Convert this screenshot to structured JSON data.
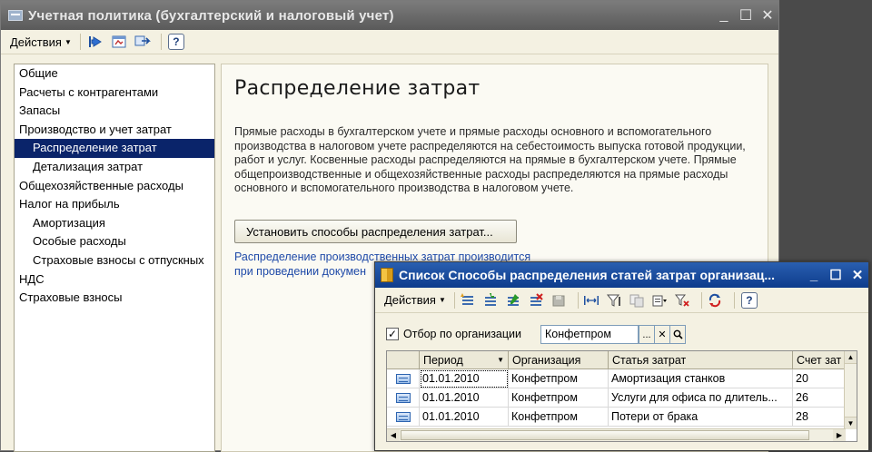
{
  "main_window": {
    "title": "Учетная политика (бухгалтерский и налоговый учет)",
    "controls": {
      "minimize": "_",
      "maximize": "☐",
      "close": "✕"
    },
    "toolbar": {
      "actions_label": "Действия",
      "help": "?"
    }
  },
  "nav": {
    "items": [
      {
        "label": "Общие",
        "sub": false
      },
      {
        "label": "Расчеты с контрагентами",
        "sub": false
      },
      {
        "label": "Запасы",
        "sub": false
      },
      {
        "label": "Производство и учет затрат",
        "sub": false
      },
      {
        "label": "Распределение затрат",
        "sub": true,
        "active": true
      },
      {
        "label": "Детализация затрат",
        "sub": true
      },
      {
        "label": "Общехозяйственные расходы",
        "sub": false
      },
      {
        "label": "Налог на прибыль",
        "sub": false
      },
      {
        "label": "Амортизация",
        "sub": true
      },
      {
        "label": "Особые расходы",
        "sub": true
      },
      {
        "label": "Страховые взносы с отпускных",
        "sub": true
      },
      {
        "label": "НДС",
        "sub": false
      },
      {
        "label": "Страховые взносы",
        "sub": false
      }
    ]
  },
  "content": {
    "heading": "Распределение затрат",
    "description": "Прямые расходы в бухгалтерском учете и прямые расходы основного и вспомогательного производства в налоговом учете распределяются на себестоимость выпуска готовой продукции, работ и услуг. Косвенные расходы распределяются на прямые в бухгалтерском учете. Прямые общепроизводственные и общехозяйственные расходы распределяются на прямые расходы основного и вспомогательного производства в налоговом учете.",
    "setup_button": "Установить способы распределения затрат...",
    "link_line1": "Распределение производственных затрат производится",
    "link_line2": "при проведении докумен"
  },
  "list_window": {
    "title": "Список Способы распределения статей затрат организац...",
    "controls": {
      "minimize": "_",
      "maximize": "☐",
      "close": "✕"
    },
    "toolbar": {
      "actions_label": "Действия",
      "help": "?"
    },
    "filter": {
      "checked": true,
      "label": "Отбор по организации",
      "value": "Конфетпром",
      "select_btn": "...",
      "clear_btn": "✕",
      "search_btn": "🔍"
    },
    "table": {
      "columns": [
        "",
        "Период",
        "Организация",
        "Статья затрат",
        "Счет зат"
      ],
      "rows": [
        {
          "period": "01.01.2010",
          "org": "Конфетпром",
          "item": "Амортизация станков",
          "account": "20"
        },
        {
          "period": "01.01.2010",
          "org": "Конфетпром",
          "item": "Услуги для офиса по длитель...",
          "account": "26"
        },
        {
          "period": "01.01.2010",
          "org": "Конфетпром",
          "item": "Потери от брака",
          "account": "28"
        }
      ]
    }
  }
}
